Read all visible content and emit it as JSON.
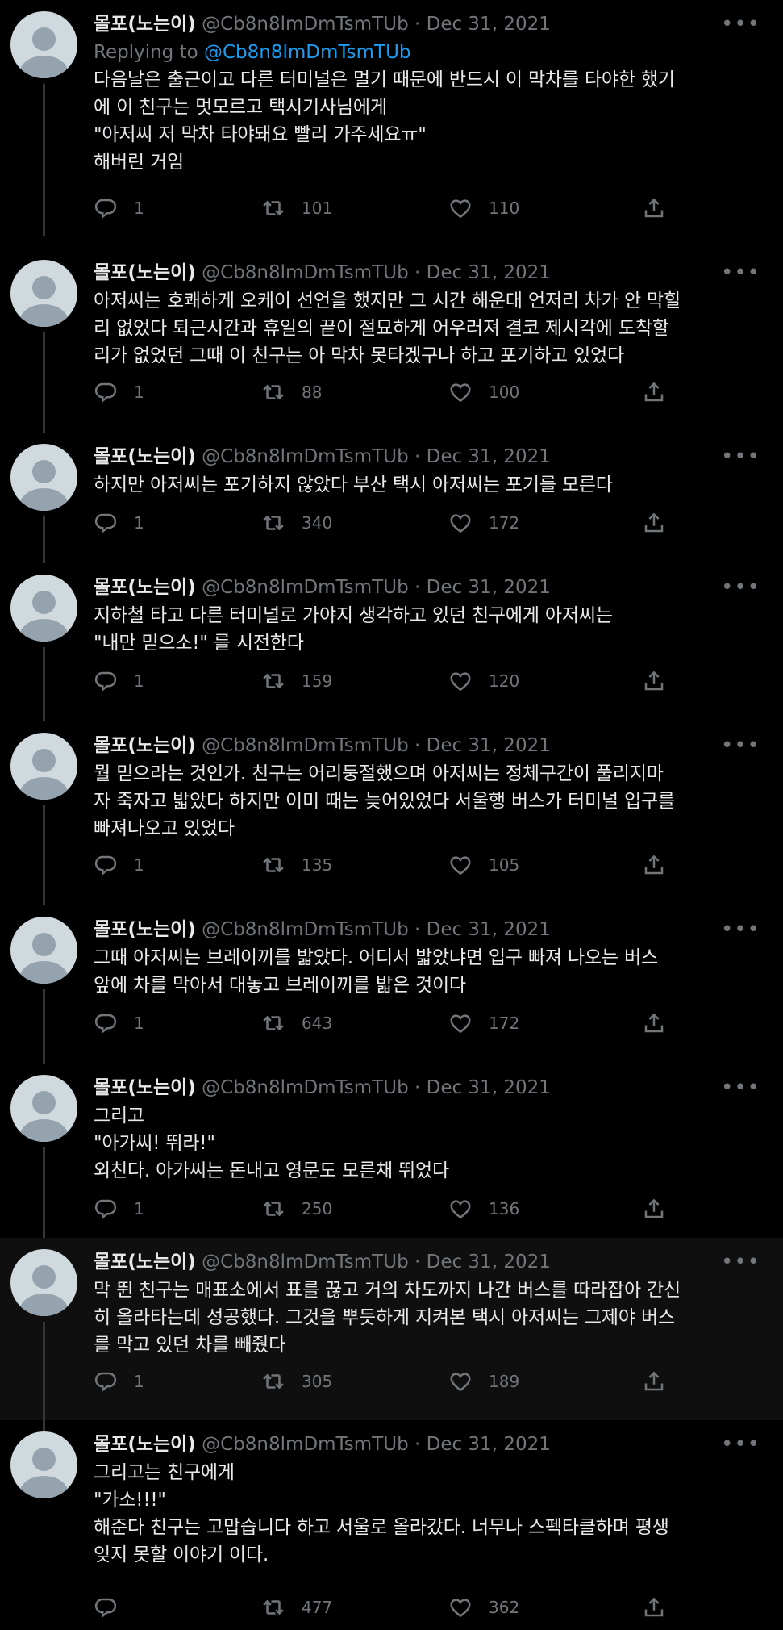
{
  "tweets": [
    {
      "name": "몰포(노는이)",
      "handle": "@Cb8n8lmDmTsmTUb",
      "date": "Dec 31, 2021",
      "replying_label": "Replying to",
      "replying_handle": "@Cb8n8lmDmTsmTUb",
      "text": "다음날은 출근이고 다른 터미널은 멀기 때문에 반드시 이 막차를 타야한 했기\n에 이 친구는 멋모르고 택시기사님에게\n\"아저씨 저 막차 타야돼요 빨리 가주세요ㅠ\"\n해버린 거임",
      "replies": "1",
      "retweets": "101",
      "likes": "110"
    },
    {
      "name": "몰포(노는이)",
      "handle": "@Cb8n8lmDmTsmTUb",
      "date": "Dec 31, 2021",
      "text": "아저씨는 호쾌하게 오케이 선언을 했지만 그 시간 해운대 언저리 차가 안 막힐\n리 없었다 퇴근시간과 휴일의 끝이 절묘하게 어우러져 결코 제시각에 도착할\n리가 없었던 그때 이 친구는 아 막차 못타겠구나 하고 포기하고 있었다",
      "replies": "1",
      "retweets": "88",
      "likes": "100"
    },
    {
      "name": "몰포(노는이)",
      "handle": "@Cb8n8lmDmTsmTUb",
      "date": "Dec 31, 2021",
      "text": "하지만 아저씨는 포기하지 않았다 부산 택시 아저씨는 포기를 모른다",
      "replies": "1",
      "retweets": "340",
      "likes": "172"
    },
    {
      "name": "몰포(노는이)",
      "handle": "@Cb8n8lmDmTsmTUb",
      "date": "Dec 31, 2021",
      "text": "지하철 타고 다른 터미널로 가야지 생각하고 있던 친구에게 아저씨는\n\"내만 믿으소!\" 를 시전한다",
      "replies": "1",
      "retweets": "159",
      "likes": "120"
    },
    {
      "name": "몰포(노는이)",
      "handle": "@Cb8n8lmDmTsmTUb",
      "date": "Dec 31, 2021",
      "text": "뭘 믿으라는 것인가. 친구는 어리둥절했으며 아저씨는 정체구간이 풀리지마\n자 죽자고 밟았다 하지만 이미 때는 늦어있었다 서울행 버스가 터미널 입구를\n빠져나오고 있었다",
      "replies": "1",
      "retweets": "135",
      "likes": "105"
    },
    {
      "name": "몰포(노는이)",
      "handle": "@Cb8n8lmDmTsmTUb",
      "date": "Dec 31, 2021",
      "text": "그때 아저씨는 브레이끼를 밟았다. 어디서 밟았냐면 입구 빠져 나오는 버스\n앞에 차를 막아서 대놓고 브레이끼를 밟은 것이다",
      "replies": "1",
      "retweets": "643",
      "likes": "172"
    },
    {
      "name": "몰포(노는이)",
      "handle": "@Cb8n8lmDmTsmTUb",
      "date": "Dec 31, 2021",
      "text": "그리고\n\"아가씨! 뛰라!\"\n외친다. 아가씨는 돈내고 영문도 모른채 뛰었다",
      "replies": "1",
      "retweets": "250",
      "likes": "136"
    },
    {
      "name": "몰포(노는이)",
      "handle": "@Cb8n8lmDmTsmTUb",
      "date": "Dec 31, 2021",
      "text": "막 뛴 친구는 매표소에서 표를 끊고 거의 차도까지 나간 버스를 따라잡아 간신\n히 올라타는데 성공했다. 그것을 뿌듯하게 지켜본 택시 아저씨는 그제야 버스\n를 막고 있던 차를 빼줬다",
      "replies": "1",
      "retweets": "305",
      "likes": "189"
    },
    {
      "name": "몰포(노는이)",
      "handle": "@Cb8n8lmDmTsmTUb",
      "date": "Dec 31, 2021",
      "text": "그리고는 친구에게\n\"가소!!!\"\n해준다 친구는 고맙습니다 하고 서울로 올라갔다. 너무나 스펙타클하며 평생\n잊지 못할 이야기 이다.",
      "replies": "",
      "retweets": "477",
      "likes": "362"
    }
  ]
}
